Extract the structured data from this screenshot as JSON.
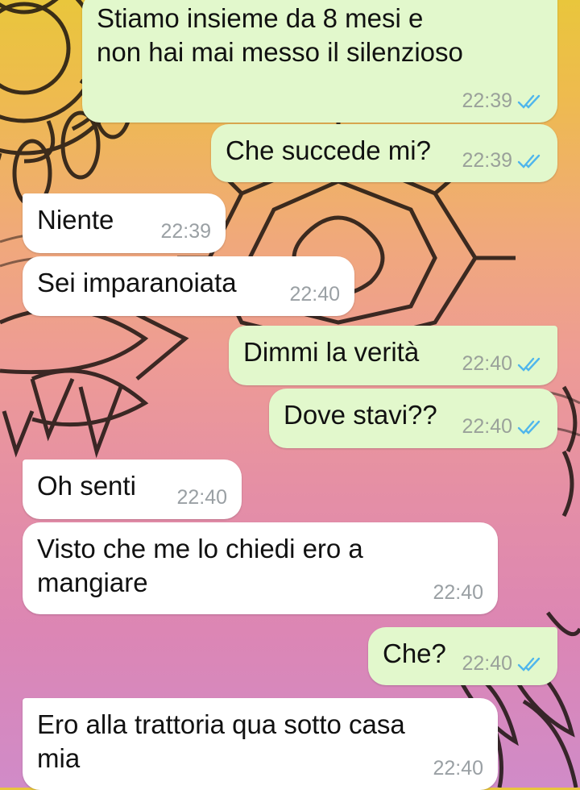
{
  "messages": [
    {
      "dir": "out",
      "text": "Stiamo insieme da 8 mesi e\nnon hai mai messo il silenzioso",
      "time": "22:39",
      "read": true
    },
    {
      "dir": "out",
      "text": "Che succede mi?",
      "time": "22:39",
      "read": true
    },
    {
      "dir": "in",
      "text": "Niente",
      "time": "22:39"
    },
    {
      "dir": "in",
      "text": "Sei imparanoiata",
      "time": "22:40"
    },
    {
      "dir": "out",
      "text": "Dimmi la verità",
      "time": "22:40",
      "read": true
    },
    {
      "dir": "out",
      "text": "Dove stavi??",
      "time": "22:40",
      "read": true
    },
    {
      "dir": "in",
      "text": "Oh senti",
      "time": "22:40"
    },
    {
      "dir": "in",
      "text": "Visto che me lo chiedi ero a\nmangiare",
      "time": "22:40"
    },
    {
      "dir": "out",
      "text": "Che?",
      "time": "22:40",
      "read": true
    },
    {
      "dir": "in",
      "text": "Ero alla trattoria qua sotto casa\nmia",
      "time": "22:40"
    }
  ],
  "colors": {
    "outgoing_bubble": "#e2f8cc",
    "incoming_bubble": "#ffffff",
    "read_ticks": "#4fb6ec",
    "timestamp": "#9aa19a"
  },
  "icons": {
    "read_receipt": "double-check-icon"
  }
}
